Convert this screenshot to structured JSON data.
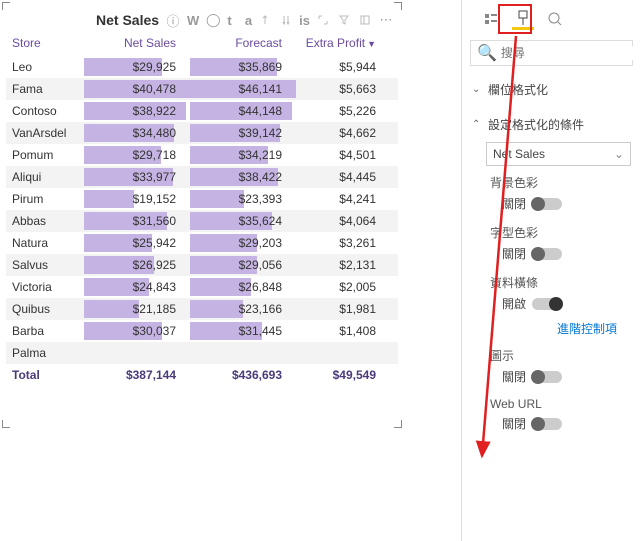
{
  "visual": {
    "title": "Net Sales",
    "tool_letters": [
      "W",
      "t",
      "a",
      "is"
    ],
    "cols": [
      "Store",
      "Net Sales",
      "Forecast",
      "Extra Profit"
    ]
  },
  "rows": [
    {
      "store": "Leo",
      "net": "$29,925",
      "fc": "$35,869",
      "ep": "$5,944",
      "nb": 74,
      "fb": 82
    },
    {
      "store": "Fama",
      "net": "$40,478",
      "fc": "$46,141",
      "ep": "$5,663",
      "nb": 100,
      "fb": 100
    },
    {
      "store": "Contoso",
      "net": "$38,922",
      "fc": "$44,148",
      "ep": "$5,226",
      "nb": 96,
      "fb": 96
    },
    {
      "store": "VanArsdel",
      "net": "$34,480",
      "fc": "$39,142",
      "ep": "$4,662",
      "nb": 85,
      "fb": 85
    },
    {
      "store": "Pomum",
      "net": "$29,718",
      "fc": "$34,219",
      "ep": "$4,501",
      "nb": 73,
      "fb": 74
    },
    {
      "store": "Aliqui",
      "net": "$33,977",
      "fc": "$38,422",
      "ep": "$4,445",
      "nb": 84,
      "fb": 83
    },
    {
      "store": "Pirum",
      "net": "$19,152",
      "fc": "$23,393",
      "ep": "$4,241",
      "nb": 47,
      "fb": 51
    },
    {
      "store": "Abbas",
      "net": "$31,560",
      "fc": "$35,624",
      "ep": "$4,064",
      "nb": 78,
      "fb": 77
    },
    {
      "store": "Natura",
      "net": "$25,942",
      "fc": "$29,203",
      "ep": "$3,261",
      "nb": 64,
      "fb": 63
    },
    {
      "store": "Salvus",
      "net": "$26,925",
      "fc": "$29,056",
      "ep": "$2,131",
      "nb": 66,
      "fb": 63
    },
    {
      "store": "Victoria",
      "net": "$24,843",
      "fc": "$26,848",
      "ep": "$2,005",
      "nb": 61,
      "fb": 58
    },
    {
      "store": "Quibus",
      "net": "$21,185",
      "fc": "$23,166",
      "ep": "$1,981",
      "nb": 52,
      "fb": 50
    },
    {
      "store": "Barba",
      "net": "$30,037",
      "fc": "$31,445",
      "ep": "$1,408",
      "nb": 74,
      "fb": 68
    },
    {
      "store": "Palma",
      "net": "",
      "fc": "",
      "ep": "",
      "nb": 0,
      "fb": 0
    }
  ],
  "total": {
    "label": "Total",
    "net": "$387,144",
    "fc": "$436,693",
    "ep": "$49,549"
  },
  "pane": {
    "search_ph": "搜尋",
    "sec_fields": "欄位格式化",
    "sec_cond": "設定格式化的條件",
    "dd_value": "Net Sales",
    "bg_color": "背景色彩",
    "font_color": "字型色彩",
    "data_bar": "資料橫條",
    "icon": "圖示",
    "web_url": "Web URL",
    "off": "關閉",
    "on": "開啟",
    "adv": "進階控制項"
  }
}
